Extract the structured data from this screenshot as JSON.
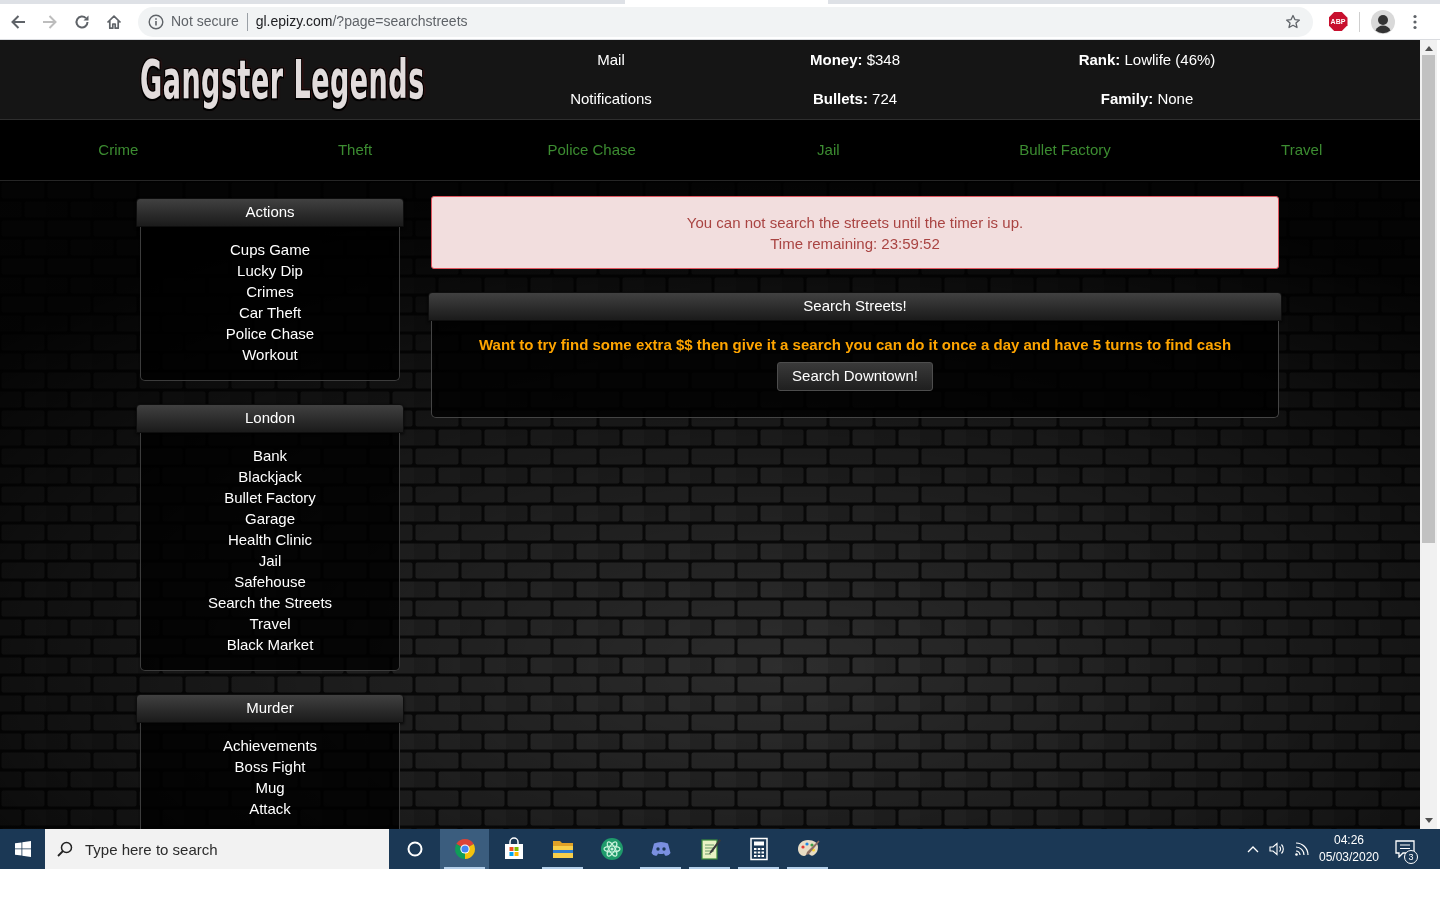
{
  "browser": {
    "nav_buttons": [
      {
        "kind": "back",
        "disabled": false
      },
      {
        "kind": "forward",
        "disabled": true
      },
      {
        "kind": "reload",
        "disabled": false
      },
      {
        "kind": "home",
        "disabled": false
      }
    ],
    "security_label": "Not secure",
    "url_host": "gl.epizy.com",
    "url_path": "/?page=searchstreets",
    "extension_label": "ABP"
  },
  "header": {
    "logo": "Gangster Legends",
    "links": [
      "Mail",
      "Notifications"
    ],
    "stat_columns": [
      [
        "**Money:** $348",
        "**Bullets:** 724"
      ],
      [
        "**Rank:** Lowlife (46%)",
        "**Family:** None"
      ]
    ]
  },
  "nav": [
    "Crime",
    "Theft",
    "Police Chase",
    "Jail",
    "Bullet Factory",
    "Travel"
  ],
  "sidebar": [
    {
      "title": "Actions",
      "items": [
        "Cups Game",
        "Lucky Dip",
        "Crimes",
        "Car Theft",
        "Police Chase",
        "Workout"
      ]
    },
    {
      "title": "London",
      "items": [
        "Bank",
        "Blackjack",
        "Bullet Factory",
        "Garage",
        "Health Clinic",
        "Jail",
        "Safehouse",
        "Search the Streets",
        "Travel",
        "Black Market"
      ]
    },
    {
      "title": "Murder",
      "items": [
        "Achievements",
        "Boss Fight",
        "Mug",
        "Attack"
      ]
    }
  ],
  "alert": {
    "message": "You can not search the streets until the timer is up.",
    "timer": "Time remaining: 23:59:52"
  },
  "search_panel": {
    "title": "Search Streets!",
    "message": "Want to try find some extra $$ then give it a search you can do it once a day and have 5 turns to find cash",
    "button": "Search Downtown!"
  },
  "taskbar": {
    "search_placeholder": "Type here to search",
    "apps": [
      {
        "kind": "browser",
        "running": true,
        "selected": true
      },
      {
        "kind": "store",
        "running": false,
        "selected": false
      },
      {
        "kind": "folder",
        "running": true,
        "selected": false
      },
      {
        "kind": "atom",
        "running": false,
        "selected": false
      },
      {
        "kind": "chat",
        "running": true,
        "selected": false
      },
      {
        "kind": "notepad",
        "running": true,
        "selected": false
      },
      {
        "kind": "calculator",
        "running": true,
        "selected": false
      },
      {
        "kind": "paint",
        "running": true,
        "selected": false
      }
    ],
    "clock": {
      "time": "04:26",
      "date": "05/03/2020"
    },
    "notification_count": "3"
  }
}
